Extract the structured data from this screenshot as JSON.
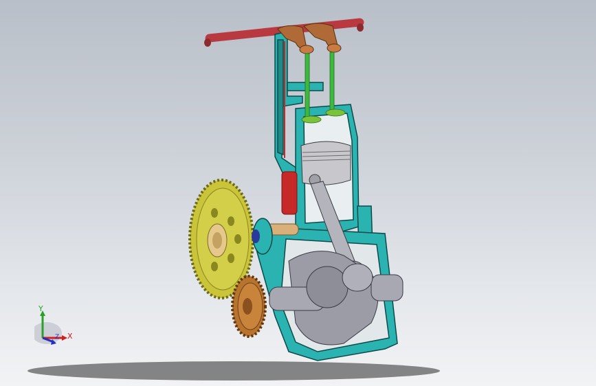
{
  "viewport": {
    "background_top": "#b9bfc8",
    "background_bottom": "#f2f3f5"
  },
  "model": {
    "type": "single-cylinder engine assembly (section view)",
    "colors": {
      "housing": "#2ab3b0",
      "housing_edge": "#0c4a4a",
      "rocker_shaft": "#b83a40",
      "pushrod": "#c72828",
      "rocker_arm": "#b06a38",
      "valve": "#3fb83f",
      "piston": "#c8c8cc",
      "crankshaft": "#9c9ca6",
      "large_gear": "#c9c43a",
      "small_gear": "#b8742e",
      "bushing": "#d9b07a"
    }
  },
  "triad": {
    "x_label": "X",
    "y_label": "Y",
    "z_label": "Z",
    "x_color": "#d02020",
    "y_color": "#2aa02a",
    "z_color": "#2030c0"
  }
}
